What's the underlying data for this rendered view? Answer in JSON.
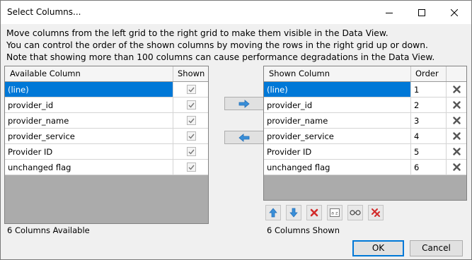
{
  "window": {
    "title": "Select Columns...",
    "controls": [
      "minimize-icon",
      "maximize-icon",
      "close-icon"
    ]
  },
  "description": [
    "Move columns from the left grid to the right grid to make them visible in the Data View.",
    "You can control the order of the shown columns by moving the rows in the right grid up or down.",
    "Note that showing more than 100 columns can cause performance degradations in the Data View."
  ],
  "available": {
    "headers": {
      "column": "Available Column",
      "shown": "Shown"
    },
    "rows": [
      {
        "name": "(line)",
        "shown": true,
        "selected": true
      },
      {
        "name": "provider_id",
        "shown": true,
        "selected": false
      },
      {
        "name": "provider_name",
        "shown": true,
        "selected": false
      },
      {
        "name": "provider_service",
        "shown": true,
        "selected": false
      },
      {
        "name": "Provider ID",
        "shown": true,
        "selected": false
      },
      {
        "name": "unchanged flag",
        "shown": true,
        "selected": false
      }
    ],
    "status": "6 Columns Available"
  },
  "shown": {
    "headers": {
      "column": "Shown Column",
      "order": "Order"
    },
    "rows": [
      {
        "name": "(line)",
        "order": "1",
        "selected": true
      },
      {
        "name": "provider_id",
        "order": "2",
        "selected": false
      },
      {
        "name": "provider_name",
        "order": "3",
        "selected": false
      },
      {
        "name": "provider_service",
        "order": "4",
        "selected": false
      },
      {
        "name": "Provider ID",
        "order": "5",
        "selected": false
      },
      {
        "name": "unchanged flag",
        "order": "6",
        "selected": false
      }
    ],
    "status": "6 Columns Shown",
    "toolbar": [
      "move-up-icon",
      "move-down-icon",
      "remove-icon",
      "sort-az-icon",
      "glasses-icon",
      "remove-all-icon"
    ]
  },
  "buttons": {
    "ok": "OK",
    "cancel": "Cancel"
  },
  "colors": {
    "selection": "#0078d7",
    "arrow": "#3a8fd8",
    "delete": "#d22b2b",
    "grid_bg": "#ababab"
  }
}
